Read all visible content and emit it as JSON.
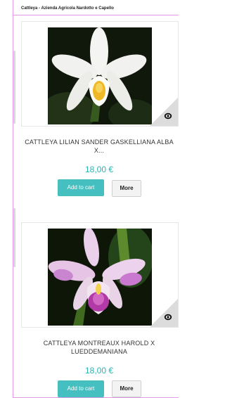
{
  "header": {
    "site_title": "Cattleya - Azienda Agricola Nardotto e Capello"
  },
  "products": [
    {
      "name_line1": "CATTLEYA LILIAN SANDER GASKELLIANA ALBA",
      "name_line2": "X...",
      "price": "18,00 €",
      "add_to_cart_label": "Add to cart",
      "more_label": "More",
      "image": "white-cattleya-orchid-photo"
    },
    {
      "name_line1": "CATTLEYA MONTREAUX HAROLD X",
      "name_line2": "LUEDDEMANIANA",
      "price": "18,00 €",
      "add_to_cart_label": "Add to cart",
      "more_label": "More",
      "image": "pink-white-cattleya-orchid-photo"
    }
  ],
  "colors": {
    "accent": "#45bfbf",
    "price": "#2cb3b3",
    "frame": "#e39be8"
  }
}
